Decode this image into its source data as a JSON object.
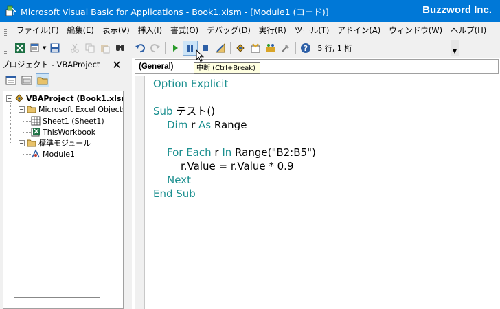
{
  "window": {
    "title": "Microsoft Visual Basic for Applications - Book1.xlsm - [Module1 (コード)]",
    "brand": "Buzzword Inc."
  },
  "menu": [
    "ファイル(F)",
    "編集(E)",
    "表示(V)",
    "挿入(I)",
    "書式(O)",
    "デバッグ(D)",
    "実行(R)",
    "ツール(T)",
    "アドイン(A)",
    "ウィンドウ(W)",
    "ヘルプ(H)"
  ],
  "toolbar": {
    "cursor_position": "5 行, 1 桁",
    "tooltip": "中断 (Ctrl+Break)"
  },
  "project": {
    "header": "プロジェクト - VBAProject",
    "close_glyph": "✕",
    "tree": {
      "root": "VBAProject (Book1.xlsm)",
      "excel_objects": "Microsoft Excel Objects",
      "sheet1": "Sheet1 (Sheet1)",
      "this_workbook": "ThisWorkbook",
      "modules_folder": "標準モジュール",
      "module1": "Module1"
    }
  },
  "code": {
    "object_combo": "(General)",
    "lines": [
      {
        "kw1": "Option Explicit",
        "rest": ""
      },
      {
        "kw1": "Sub",
        "rest": " テスト()"
      },
      {
        "kw1": "Dim",
        "mid": " r ",
        "kw2": "As",
        "rest": " Range"
      },
      {
        "kw1": "For Each",
        "mid": " r ",
        "kw2": "In",
        "rest": " Range(\"B2:B5\")"
      },
      {
        "kw1": "",
        "rest": "r.Value = r.Value * 0.9"
      },
      {
        "kw1": "Next",
        "rest": ""
      },
      {
        "kw1": "End Sub",
        "rest": ""
      }
    ]
  },
  "icons": [
    "vba-app-icon",
    "excel-view-icon",
    "insert-module-icon",
    "save-icon",
    "cut-icon",
    "copy-icon",
    "paste-icon",
    "find-icon",
    "undo-icon",
    "redo-icon",
    "run-icon",
    "break-icon",
    "reset-icon",
    "design-mode-icon",
    "project-explorer-icon",
    "properties-icon",
    "object-browser-icon",
    "toolbox-icon",
    "help-icon",
    "view-code-icon",
    "view-object-icon",
    "toggle-folders-icon"
  ],
  "colors": {
    "titlebar": "#0078d7",
    "keyword": "#1b8f8f",
    "tooltip_bg": "#ffffe1"
  }
}
